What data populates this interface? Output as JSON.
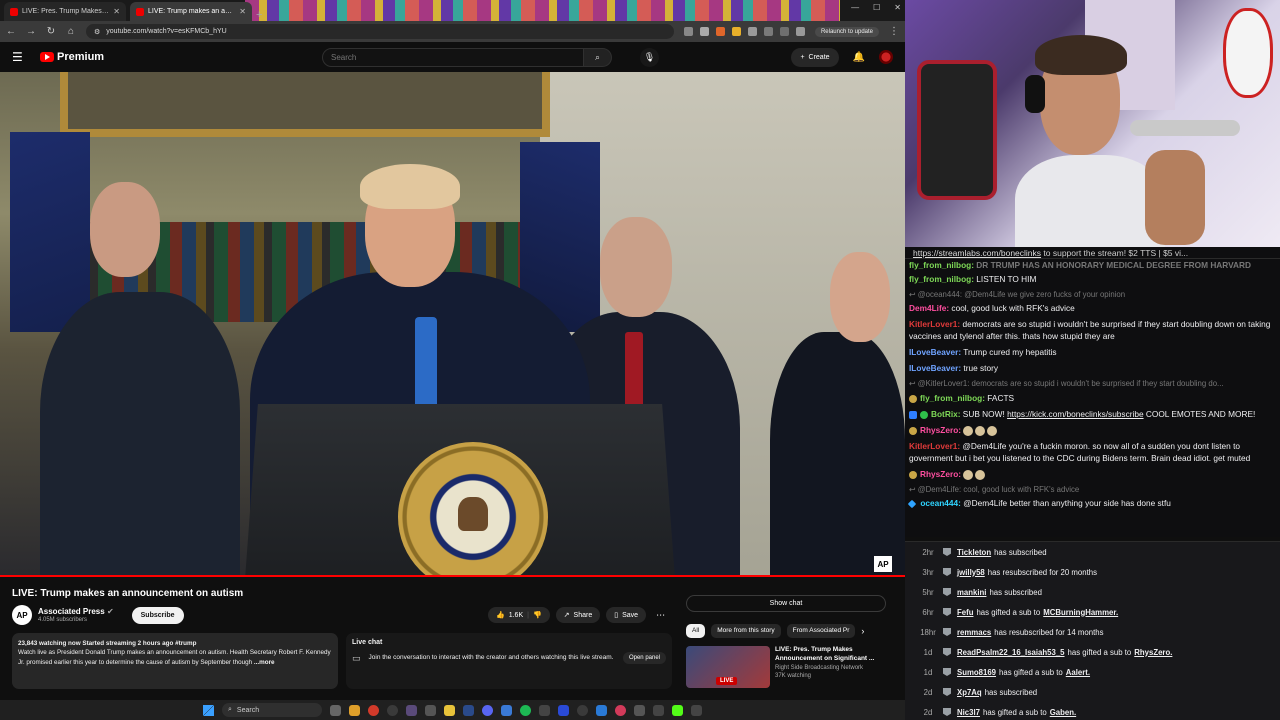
{
  "browser": {
    "tabs": [
      {
        "label": "LIVE: Pres. Trump Makes Anno...",
        "active": false
      },
      {
        "label": "LIVE: Trump makes an anno...",
        "active": true
      }
    ],
    "url": "youtube.com/watch?v=esKFMCb_hYU",
    "relaunch_label": "Relaunch to update"
  },
  "yt": {
    "logo_text": "Premium",
    "search_placeholder": "Search",
    "create_label": "Create"
  },
  "video": {
    "title": "LIVE: Trump makes an announcement on autism",
    "overlay_badge": "AP",
    "channel": {
      "name": "Associated Press",
      "subs": "4.05M subscribers",
      "avatar_text": "AP"
    },
    "subscribe_label": "Subscribe",
    "like_count": "1.6K",
    "share_label": "Share",
    "save_label": "Save",
    "description": {
      "stats": "23,843 watching now  Started streaming 2 hours ago  #trump",
      "text": "Watch live as President Donald Trump makes an announcement on autism. Health Secretary Robert F. Kennedy Jr. promised earlier this year to determine the cause of autism by September though",
      "more": "...more"
    },
    "live_chat": {
      "title": "Live chat",
      "text": "Join the conversation to interact with the creator and others watching this live stream.",
      "button": "Open panel"
    },
    "sidebar": {
      "show_chat": "Show chat",
      "chips": [
        "All",
        "More from this story",
        "From Associated Pr"
      ],
      "rec": {
        "title": "LIVE: Pres. Trump Makes Announcement on Significant ...",
        "channel": "Right Side Broadcasting Network",
        "views": "37K watching",
        "live": "LIVE"
      }
    }
  },
  "chat": {
    "banner": {
      "link": "https://streamlabs.com/boneclinks",
      "text": " to support the stream! $2 TTS | $5 vi..."
    },
    "messages": [
      {
        "user": "fly_from_nilbog:",
        "text": " DR TRUMP HAS AN HONORARY MEDICAL DEGREE FROM HARVARD",
        "cut": true
      },
      {
        "user": "fly_from_nilbog:",
        "text": " LISTEN TO HIM"
      },
      {
        "reply": "@ocean444: @Dem4Life we give zero fucks of your opinion"
      },
      {
        "user": "Dem4Life:",
        "text": " cool, good luck with RFK's advice"
      },
      {
        "user": "KitlerLover1:",
        "text": " democrats are so stupid i wouldn't be surprised if they start doubling down on taking vaccines and tylenol after this. thats how stupid they are"
      },
      {
        "user": "ILoveBeaver:",
        "text": " Trump cured my hepatitis"
      },
      {
        "user": "ILoveBeaver:",
        "text": " true story"
      },
      {
        "reply": "@KitlerLover1: democrats are so stupid i wouldn't be surprised if they start doubling do..."
      },
      {
        "user": "fly_from_nilbog:",
        "text": " FACTS"
      },
      {
        "user": "BotRix:",
        "text": " SUB NOW! ",
        "link": "https://kick.com/boneclinks/subscribe",
        "after": " COOL EMOTES AND MORE!"
      },
      {
        "user": "RhysZero:",
        "text": ""
      },
      {
        "user": "KitlerLover1:",
        "text": " @Dem4Life you're a fuckin moron. so now all of a sudden you dont listen to government but i bet you listened to the CDC during Bidens term. Brain dead idiot. get muted"
      },
      {
        "user": "RhysZero:",
        "text": ""
      },
      {
        "reply": "@Dem4Life: cool, good luck with RFK's advice"
      },
      {
        "user": "ocean444:",
        "text": " @Dem4Life better than anything your side has done stfu"
      }
    ]
  },
  "events": [
    {
      "time": "2hr",
      "user": "Tickleton",
      "action": "has subscribed",
      "target": ""
    },
    {
      "time": "3hr",
      "user": "jwilly58",
      "action": "has resubscribed for 20 months",
      "target": ""
    },
    {
      "time": "5hr",
      "user": "mankini",
      "action": "has subscribed",
      "target": ""
    },
    {
      "time": "6hr",
      "user": "Fefu",
      "action": "has gifted a sub to",
      "target": "MCBurningHammer."
    },
    {
      "time": "18hr",
      "user": "remmacs",
      "action": "has resubscribed for 14 months",
      "target": ""
    },
    {
      "time": "1d",
      "user": "ReadPsalm22_16_Isaiah53_5",
      "action": "has gifted a sub to",
      "target": "RhysZero."
    },
    {
      "time": "1d",
      "user": "Sumo8169",
      "action": "has gifted a sub to",
      "target": "Aalert."
    },
    {
      "time": "2d",
      "user": "Xp7Aq",
      "action": "has subscribed",
      "target": ""
    },
    {
      "time": "2d",
      "user": "Nic3l7",
      "action": "has gifted a sub to",
      "target": "Gaben."
    }
  ],
  "taskbar": {
    "search_label": "Search"
  },
  "colors": {
    "yt_red": "#ff0000",
    "chat_bg": "#0e0e10",
    "events_bg": "#18181b"
  }
}
